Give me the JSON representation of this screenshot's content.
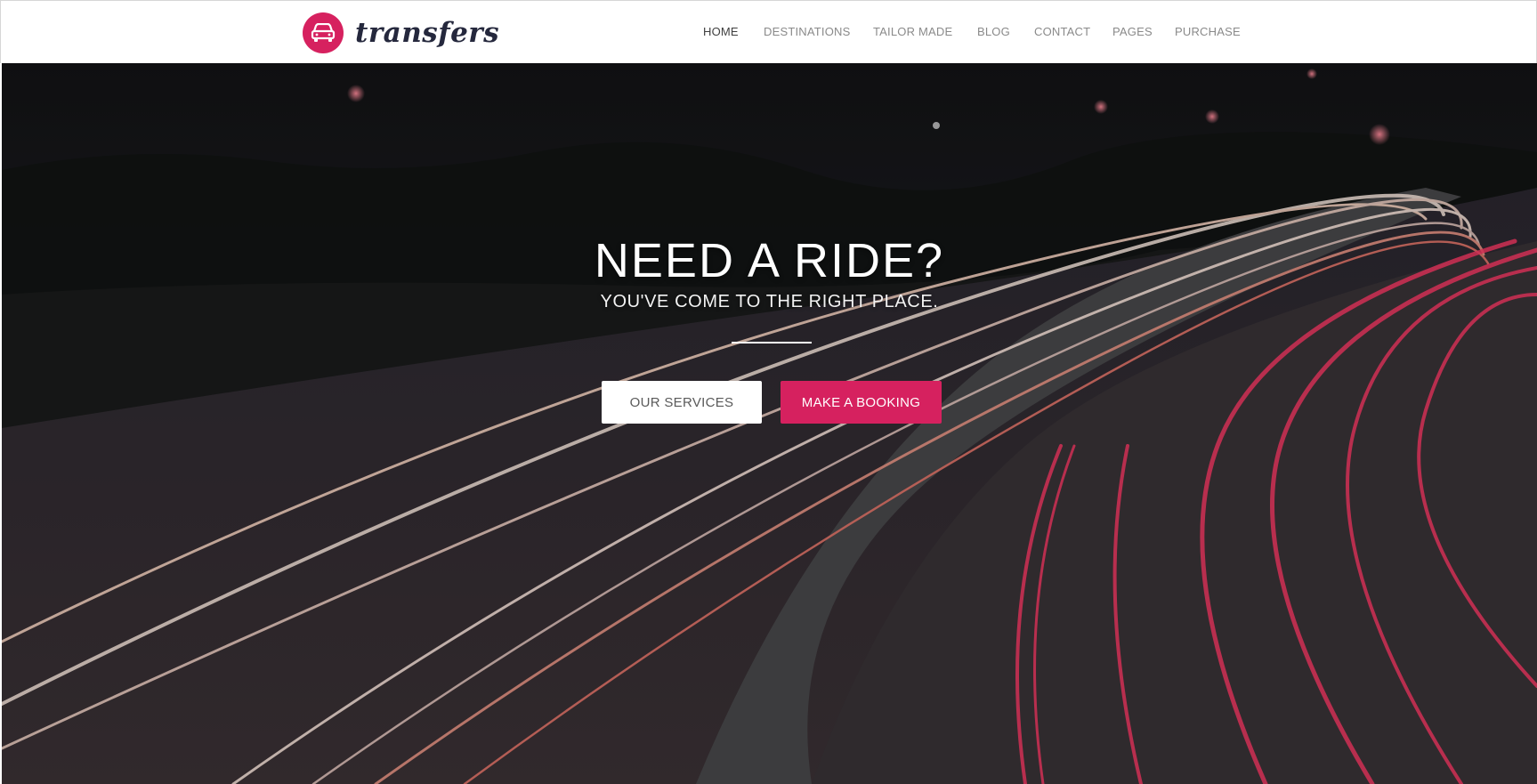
{
  "header": {
    "logo_text": "transfers",
    "logo_icon": "car-front-icon",
    "nav": [
      {
        "label": "HOME",
        "active": true
      },
      {
        "label": "DESTINATIONS",
        "active": false
      },
      {
        "label": "TAILOR MADE",
        "active": false
      },
      {
        "label": "BLOG",
        "active": false
      },
      {
        "label": "CONTACT",
        "active": false
      },
      {
        "label": "PAGES",
        "active": false
      },
      {
        "label": "PURCHASE",
        "active": false
      }
    ]
  },
  "hero": {
    "title": "NEED A RIDE?",
    "subtitle": "YOU'VE COME TO THE RIGHT PLACE.",
    "buttons": {
      "services": "OUR SERVICES",
      "booking": "MAKE A BOOKING"
    }
  },
  "colors": {
    "accent": "#d6215f",
    "nav_text": "#8a8a8a",
    "nav_active": "#3f3f3f",
    "logo_text": "#25283d"
  }
}
